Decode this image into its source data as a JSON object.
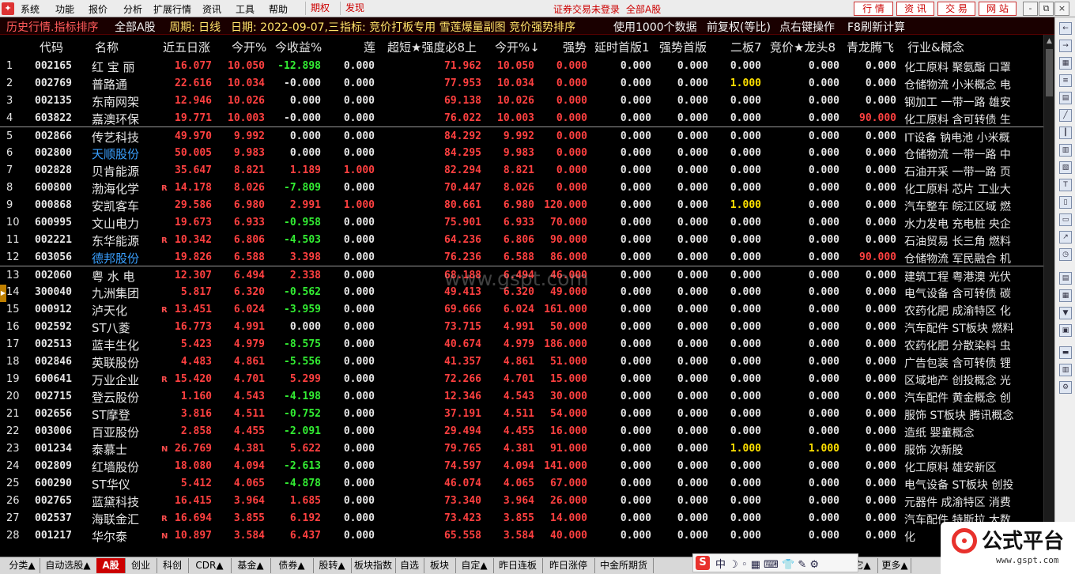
{
  "menubar": {
    "items": [
      "系统",
      "功能",
      "报价",
      "分析",
      "扩展行情",
      "资讯",
      "工具",
      "帮助"
    ],
    "mode_tabs": [
      "期权",
      "发现"
    ],
    "status": "证券交易未登录",
    "market": "全部A股",
    "right_buttons": [
      "行 情",
      "资 讯",
      "交 易",
      "网 站"
    ],
    "window_buttons": [
      "-",
      "⧉",
      "×"
    ]
  },
  "titlebar": {
    "title": "历史行情.指标排序",
    "market": "全部A股",
    "period": "周期: 日线",
    "date": "日期: 2022-09-07,三",
    "indicator": "指标: 竞价打板专用 雪莲爆量副图 竞价强势排序",
    "usage": "使用1000个数据",
    "fq": "前复权(等比)",
    "hint": "点右键操作",
    "refresh": "F8刷新计算"
  },
  "columns": [
    "代码",
    "名称",
    "近五日涨",
    "今开%",
    "今收益%",
    "莲",
    "超短★强度必8上",
    "今开%↓",
    "强势",
    "延时首版1",
    "强势首版",
    "二板7",
    "竞价★龙头8",
    "青龙腾飞",
    "行业&概念"
  ],
  "rows": [
    {
      "i": "1",
      "code": "002165",
      "name": "红 宝 丽",
      "nc": "wht",
      "flag": "",
      "v": [
        "16.077",
        "10.050",
        "-12.898",
        "0.000",
        "71.962",
        "10.050",
        "0.000",
        "0.000",
        "0.000",
        "0.000",
        "0.000",
        "0.000"
      ],
      "ind": "化工原料 聚氨酯 口罩"
    },
    {
      "i": "2",
      "code": "002769",
      "name": "普路通",
      "nc": "wht",
      "flag": "",
      "v": [
        "22.616",
        "10.034",
        "-0.000",
        "0.000",
        "77.953",
        "10.034",
        "0.000",
        "0.000",
        "0.000",
        "1.000",
        "0.000",
        "0.000"
      ],
      "ind": "仓储物流 小米概念 电"
    },
    {
      "i": "3",
      "code": "002135",
      "name": "东南网架",
      "nc": "wht",
      "flag": "",
      "v": [
        "12.946",
        "10.026",
        "0.000",
        "0.000",
        "69.138",
        "10.026",
        "0.000",
        "0.000",
        "0.000",
        "0.000",
        "0.000",
        "0.000"
      ],
      "ind": "钢加工 一带一路 雄安"
    },
    {
      "i": "4",
      "code": "603822",
      "name": "嘉澳环保",
      "nc": "wht",
      "flag": "",
      "v": [
        "19.771",
        "10.003",
        "-0.000",
        "0.000",
        "76.022",
        "10.003",
        "0.000",
        "0.000",
        "0.000",
        "0.000",
        "0.000",
        "90.000"
      ],
      "ind": "化工原料 含可转债 生"
    },
    {
      "i": "5",
      "code": "002866",
      "name": "传艺科技",
      "nc": "wht",
      "flag": "",
      "v": [
        "49.970",
        "9.992",
        "0.000",
        "0.000",
        "84.292",
        "9.992",
        "0.000",
        "0.000",
        "0.000",
        "0.000",
        "0.000",
        "0.000"
      ],
      "ind": "IT设备 钠电池 小米概"
    },
    {
      "i": "6",
      "code": "002800",
      "name": "天顺股份",
      "nc": "blu",
      "flag": "",
      "v": [
        "50.005",
        "9.983",
        "0.000",
        "0.000",
        "84.295",
        "9.983",
        "0.000",
        "0.000",
        "0.000",
        "0.000",
        "0.000",
        "0.000"
      ],
      "ind": "仓储物流 一带一路 中"
    },
    {
      "i": "7",
      "code": "002828",
      "name": "贝肯能源",
      "nc": "wht",
      "flag": "",
      "v": [
        "35.647",
        "8.821",
        "1.189",
        "1.000",
        "82.294",
        "8.821",
        "0.000",
        "0.000",
        "0.000",
        "0.000",
        "0.000",
        "0.000"
      ],
      "ind": "石油开采 一带一路 页"
    },
    {
      "i": "8",
      "code": "600800",
      "name": "渤海化学",
      "nc": "wht",
      "flag": "R",
      "v": [
        "14.178",
        "8.026",
        "-7.809",
        "0.000",
        "70.447",
        "8.026",
        "0.000",
        "0.000",
        "0.000",
        "0.000",
        "0.000",
        "0.000"
      ],
      "ind": "化工原料 芯片 工业大"
    },
    {
      "i": "9",
      "code": "000868",
      "name": "安凯客车",
      "nc": "wht",
      "flag": "",
      "v": [
        "29.586",
        "6.980",
        "2.991",
        "1.000",
        "80.661",
        "6.980",
        "120.000",
        "0.000",
        "0.000",
        "1.000",
        "0.000",
        "0.000"
      ],
      "ind": "汽车整车 皖江区域 燃"
    },
    {
      "i": "10",
      "code": "600995",
      "name": "文山电力",
      "nc": "wht",
      "flag": "",
      "v": [
        "19.673",
        "6.933",
        "-0.958",
        "0.000",
        "75.901",
        "6.933",
        "70.000",
        "0.000",
        "0.000",
        "0.000",
        "0.000",
        "0.000"
      ],
      "ind": "水力发电 充电桩 央企"
    },
    {
      "i": "11",
      "code": "002221",
      "name": "东华能源",
      "nc": "wht",
      "flag": "R",
      "v": [
        "10.342",
        "6.806",
        "-4.503",
        "0.000",
        "64.236",
        "6.806",
        "90.000",
        "0.000",
        "0.000",
        "0.000",
        "0.000",
        "0.000"
      ],
      "ind": "石油贸易 长三角 燃料"
    },
    {
      "i": "12",
      "code": "603056",
      "name": "德邦股份",
      "nc": "blu",
      "flag": "",
      "v": [
        "19.826",
        "6.588",
        "3.398",
        "0.000",
        "76.236",
        "6.588",
        "86.000",
        "0.000",
        "0.000",
        "0.000",
        "0.000",
        "90.000"
      ],
      "ind": "仓储物流 军民融合 机"
    },
    {
      "i": "13",
      "code": "002060",
      "name": "粤 水 电",
      "nc": "wht",
      "flag": "",
      "v": [
        "12.307",
        "6.494",
        "2.338",
        "0.000",
        "68.188",
        "6.494",
        "46.000",
        "0.000",
        "0.000",
        "0.000",
        "0.000",
        "0.000"
      ],
      "ind": "建筑工程 粤港澳 光伏"
    },
    {
      "i": "14",
      "code": "300040",
      "name": "九洲集团",
      "nc": "wht",
      "flag": "",
      "v": [
        "5.817",
        "6.320",
        "-0.562",
        "0.000",
        "49.413",
        "6.320",
        "49.000",
        "0.000",
        "0.000",
        "0.000",
        "0.000",
        "0.000"
      ],
      "ind": "电气设备 含可转债 碳"
    },
    {
      "i": "15",
      "code": "000912",
      "name": "泸天化",
      "nc": "wht",
      "flag": "R",
      "v": [
        "13.451",
        "6.024",
        "-3.959",
        "0.000",
        "69.666",
        "6.024",
        "161.000",
        "0.000",
        "0.000",
        "0.000",
        "0.000",
        "0.000"
      ],
      "ind": "农药化肥 成渝特区 化"
    },
    {
      "i": "16",
      "code": "002592",
      "name": "ST八菱",
      "nc": "wht",
      "flag": "",
      "v": [
        "16.773",
        "4.991",
        "0.000",
        "0.000",
        "73.715",
        "4.991",
        "50.000",
        "0.000",
        "0.000",
        "0.000",
        "0.000",
        "0.000"
      ],
      "ind": "汽车配件 ST板块 燃料"
    },
    {
      "i": "17",
      "code": "002513",
      "name": "蓝丰生化",
      "nc": "wht",
      "flag": "",
      "v": [
        "5.423",
        "4.979",
        "-8.575",
        "0.000",
        "40.674",
        "4.979",
        "186.000",
        "0.000",
        "0.000",
        "0.000",
        "0.000",
        "0.000"
      ],
      "ind": "农药化肥 分散染料 虫"
    },
    {
      "i": "18",
      "code": "002846",
      "name": "英联股份",
      "nc": "wht",
      "flag": "",
      "v": [
        "4.483",
        "4.861",
        "-5.556",
        "0.000",
        "41.357",
        "4.861",
        "51.000",
        "0.000",
        "0.000",
        "0.000",
        "0.000",
        "0.000"
      ],
      "ind": "广告包装 含可转债 锂"
    },
    {
      "i": "19",
      "code": "600641",
      "name": "万业企业",
      "nc": "wht",
      "flag": "R",
      "v": [
        "15.420",
        "4.701",
        "5.299",
        "0.000",
        "72.266",
        "4.701",
        "15.000",
        "0.000",
        "0.000",
        "0.000",
        "0.000",
        "0.000"
      ],
      "ind": "区域地产 创投概念 光"
    },
    {
      "i": "20",
      "code": "002715",
      "name": "登云股份",
      "nc": "wht",
      "flag": "",
      "v": [
        "1.160",
        "4.543",
        "-4.198",
        "0.000",
        "12.346",
        "4.543",
        "30.000",
        "0.000",
        "0.000",
        "0.000",
        "0.000",
        "0.000"
      ],
      "ind": "汽车配件 黄金概念 创"
    },
    {
      "i": "21",
      "code": "002656",
      "name": "ST摩登",
      "nc": "wht",
      "flag": "",
      "v": [
        "3.816",
        "4.511",
        "-0.752",
        "0.000",
        "37.191",
        "4.511",
        "54.000",
        "0.000",
        "0.000",
        "0.000",
        "0.000",
        "0.000"
      ],
      "ind": "服饰 ST板块 腾讯概念"
    },
    {
      "i": "22",
      "code": "003006",
      "name": "百亚股份",
      "nc": "wht",
      "flag": "",
      "v": [
        "2.858",
        "4.455",
        "-2.091",
        "0.000",
        "29.494",
        "4.455",
        "16.000",
        "0.000",
        "0.000",
        "0.000",
        "0.000",
        "0.000"
      ],
      "ind": "造纸 婴童概念"
    },
    {
      "i": "23",
      "code": "001234",
      "name": "泰慕士",
      "nc": "wht",
      "flag": "N",
      "v": [
        "26.769",
        "4.381",
        "5.622",
        "0.000",
        "79.765",
        "4.381",
        "91.000",
        "0.000",
        "0.000",
        "1.000",
        "1.000",
        "0.000"
      ],
      "ind": "服饰 次新股"
    },
    {
      "i": "24",
      "code": "002809",
      "name": "红墙股份",
      "nc": "wht",
      "flag": "",
      "v": [
        "18.080",
        "4.094",
        "-2.613",
        "0.000",
        "74.597",
        "4.094",
        "141.000",
        "0.000",
        "0.000",
        "0.000",
        "0.000",
        "0.000"
      ],
      "ind": "化工原料 雄安新区"
    },
    {
      "i": "25",
      "code": "600290",
      "name": "ST华仪",
      "nc": "wht",
      "flag": "",
      "v": [
        "5.412",
        "4.065",
        "-4.878",
        "0.000",
        "46.074",
        "4.065",
        "67.000",
        "0.000",
        "0.000",
        "0.000",
        "0.000",
        "0.000"
      ],
      "ind": "电气设备 ST板块 创投"
    },
    {
      "i": "26",
      "code": "002765",
      "name": "蓝黛科技",
      "nc": "wht",
      "flag": "",
      "v": [
        "16.415",
        "3.964",
        "1.685",
        "0.000",
        "73.340",
        "3.964",
        "26.000",
        "0.000",
        "0.000",
        "0.000",
        "0.000",
        "0.000"
      ],
      "ind": "元器件 成渝特区 消费"
    },
    {
      "i": "27",
      "code": "002537",
      "name": "海联金汇",
      "nc": "wht",
      "flag": "R",
      "v": [
        "16.694",
        "3.855",
        "6.192",
        "0.000",
        "73.423",
        "3.855",
        "14.000",
        "0.000",
        "0.000",
        "0.000",
        "0.000",
        "0.000"
      ],
      "ind": "汽车配件 特斯拉 大数"
    },
    {
      "i": "28",
      "code": "001217",
      "name": "华尔泰",
      "nc": "wht",
      "flag": "N",
      "v": [
        "10.897",
        "3.584",
        "6.437",
        "0.000",
        "65.558",
        "3.584",
        "40.000",
        "0.000",
        "0.000",
        "0.000",
        "0.000",
        "0.000"
      ],
      "ind": "化"
    }
  ],
  "watermark": "www.gspt.com",
  "bottom_tabs": [
    "分类▲",
    "自动选股▲",
    "A股",
    "创业",
    "科创",
    "CDR▲",
    "基金▲",
    "债券▲",
    "股转▲",
    "板块指数",
    "自选",
    "板块",
    "自定▲",
    "昨日连板",
    "昨日涨停",
    "中金所期货",
    "其它▲",
    "更多▲"
  ],
  "ime": {
    "logo": "S",
    "text": "中 ☽ ◦ ▦ ⌨ 👕 ✎ ⚙"
  },
  "brand": {
    "name": "公式平台",
    "url": "www.gspt.com"
  },
  "colors": {
    "up": "#ff4040",
    "down": "#33ee33",
    "neutral": "#e6e6e6",
    "highlight": "#ffe100",
    "link": "#3aa0ff"
  }
}
